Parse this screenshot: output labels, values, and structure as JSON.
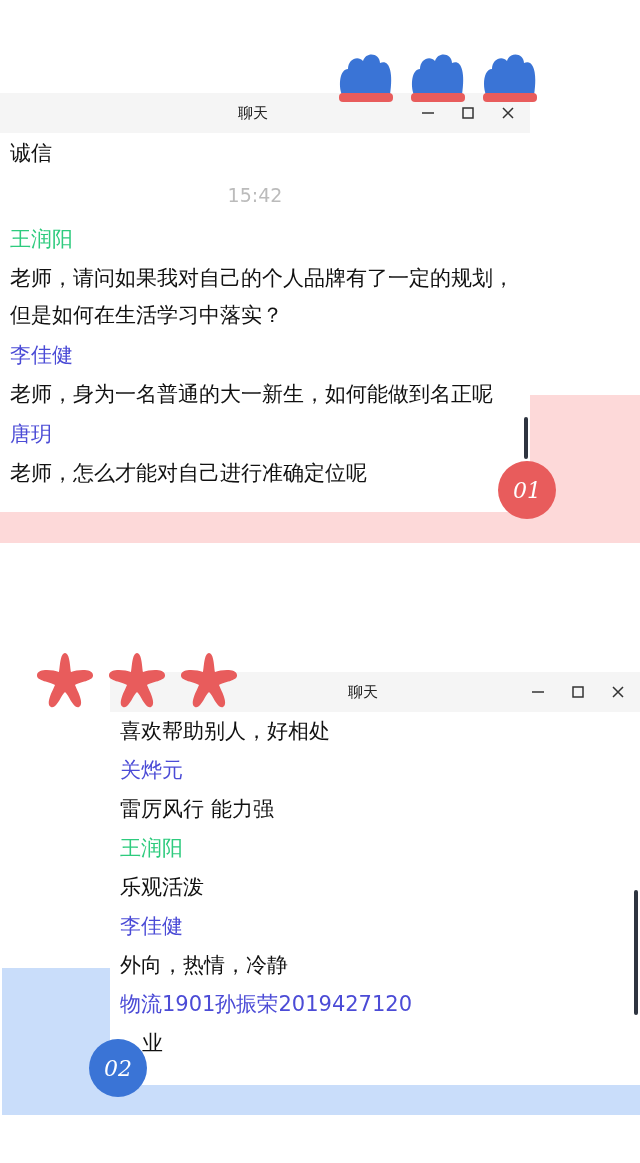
{
  "panels": [
    {
      "title": "聊天",
      "kind": "red",
      "badge": "01",
      "items": [
        {
          "kind": "text",
          "text": "诚信"
        },
        {
          "kind": "time",
          "text": "15:42"
        },
        {
          "kind": "name",
          "text": "王润阳",
          "color": "#2ecb7e"
        },
        {
          "kind": "text",
          "text": "老师，请问如果我对自己的个人品牌有了一定的规划，但是如何在生活学习中落实？"
        },
        {
          "kind": "name",
          "text": "李佳健",
          "color": "#4b4bd6"
        },
        {
          "kind": "text",
          "text": "老师，身为一名普通的大一新生，如何能做到名正呢"
        },
        {
          "kind": "name",
          "text": "唐玥",
          "color": "#4b4bd6"
        },
        {
          "kind": "text",
          "text": "老师，怎么才能对自己进行准确定位呢"
        }
      ]
    },
    {
      "title": "聊天",
      "kind": "blue",
      "badge": "02",
      "items": [
        {
          "kind": "text",
          "text": "喜欢帮助别人，好相处"
        },
        {
          "kind": "name",
          "text": "关烨元",
          "color": "#4b4bd6"
        },
        {
          "kind": "text",
          "text": "雷厉风行  能力强"
        },
        {
          "kind": "name",
          "text": "王润阳",
          "color": "#2ecb7e"
        },
        {
          "kind": "text",
          "text": "乐观活泼"
        },
        {
          "kind": "name",
          "text": "李佳健",
          "color": "#4b4bd6"
        },
        {
          "kind": "text",
          "text": "外向，热情，冷静"
        },
        {
          "kind": "name",
          "text": "物流1901孙振荣2019427120",
          "color": "#4b4bd6"
        },
        {
          "kind": "covered",
          "text": "业"
        }
      ]
    }
  ]
}
